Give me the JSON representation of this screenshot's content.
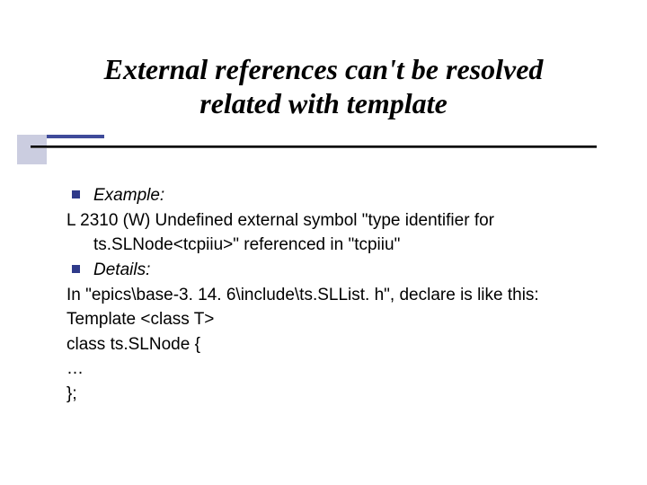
{
  "title": {
    "line1": "External references can't be resolved",
    "line2": "related with template"
  },
  "body": {
    "bullet1_label": "Example:",
    "example_line1": "L 2310 (W) Undefined external symbol \"type identifier for",
    "example_line2": "ts.SLNode<tcpiiu>\" referenced in \"tcpiiu\"",
    "bullet2_label": "Details:",
    "details_line1": "In \"epics\\base-3. 14. 6\\include\\ts.SLList. h\", declare is like this:",
    "code_line1": "Template <class T>",
    "code_line2": "class ts.SLNode {",
    "code_line3": "…",
    "code_line4": "};"
  }
}
